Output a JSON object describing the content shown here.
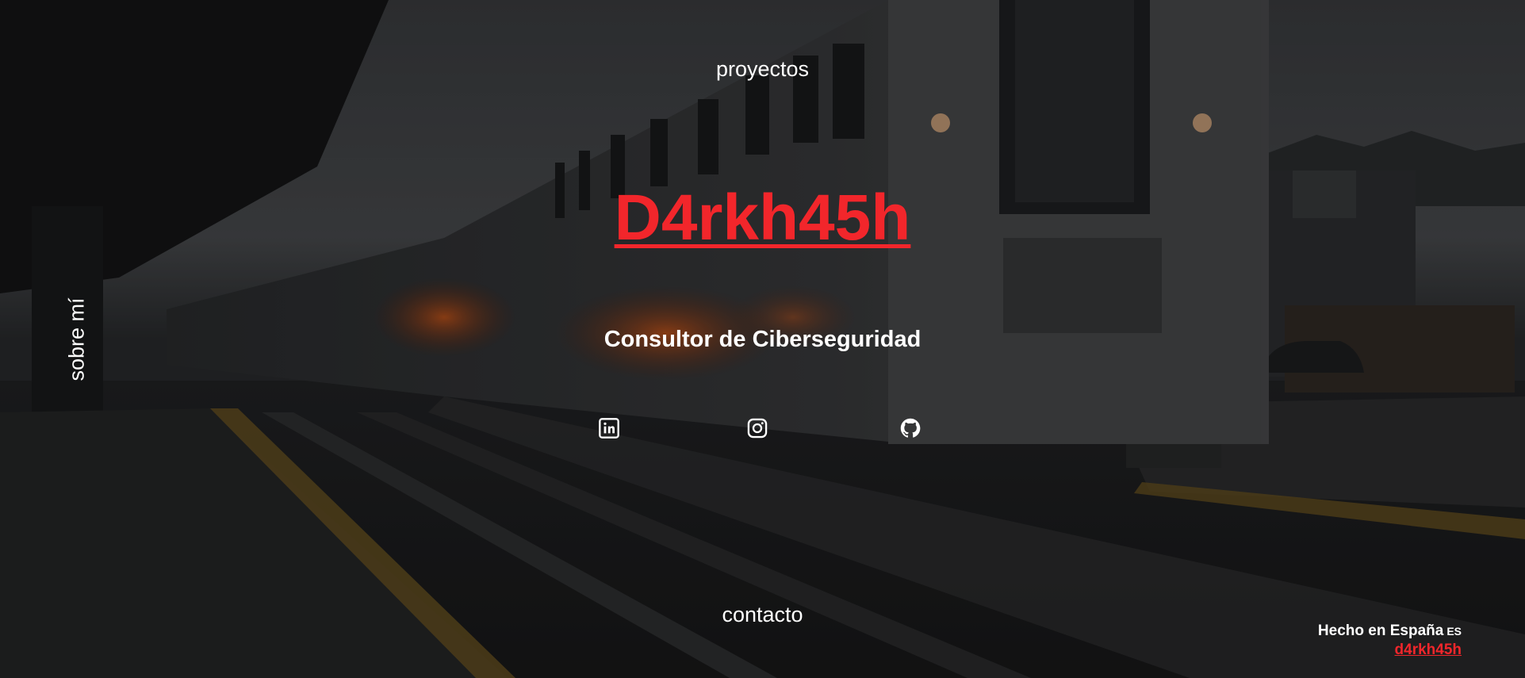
{
  "nav": {
    "top": "proyectos",
    "left": "sobre mí",
    "bottom": "contacto"
  },
  "hero": {
    "title": "D4rkh45h",
    "subtitle": "Consultor de Ciberseguridad"
  },
  "social": [
    {
      "name": "linkedin-icon"
    },
    {
      "name": "instagram-icon"
    },
    {
      "name": "github-icon"
    }
  ],
  "footer": {
    "made_in": "Hecho en España",
    "flag": "ES",
    "credit": "d4rkh45h"
  },
  "colors": {
    "accent": "#f2262b",
    "text": "#ffffff",
    "background": "#1b1c1e"
  }
}
